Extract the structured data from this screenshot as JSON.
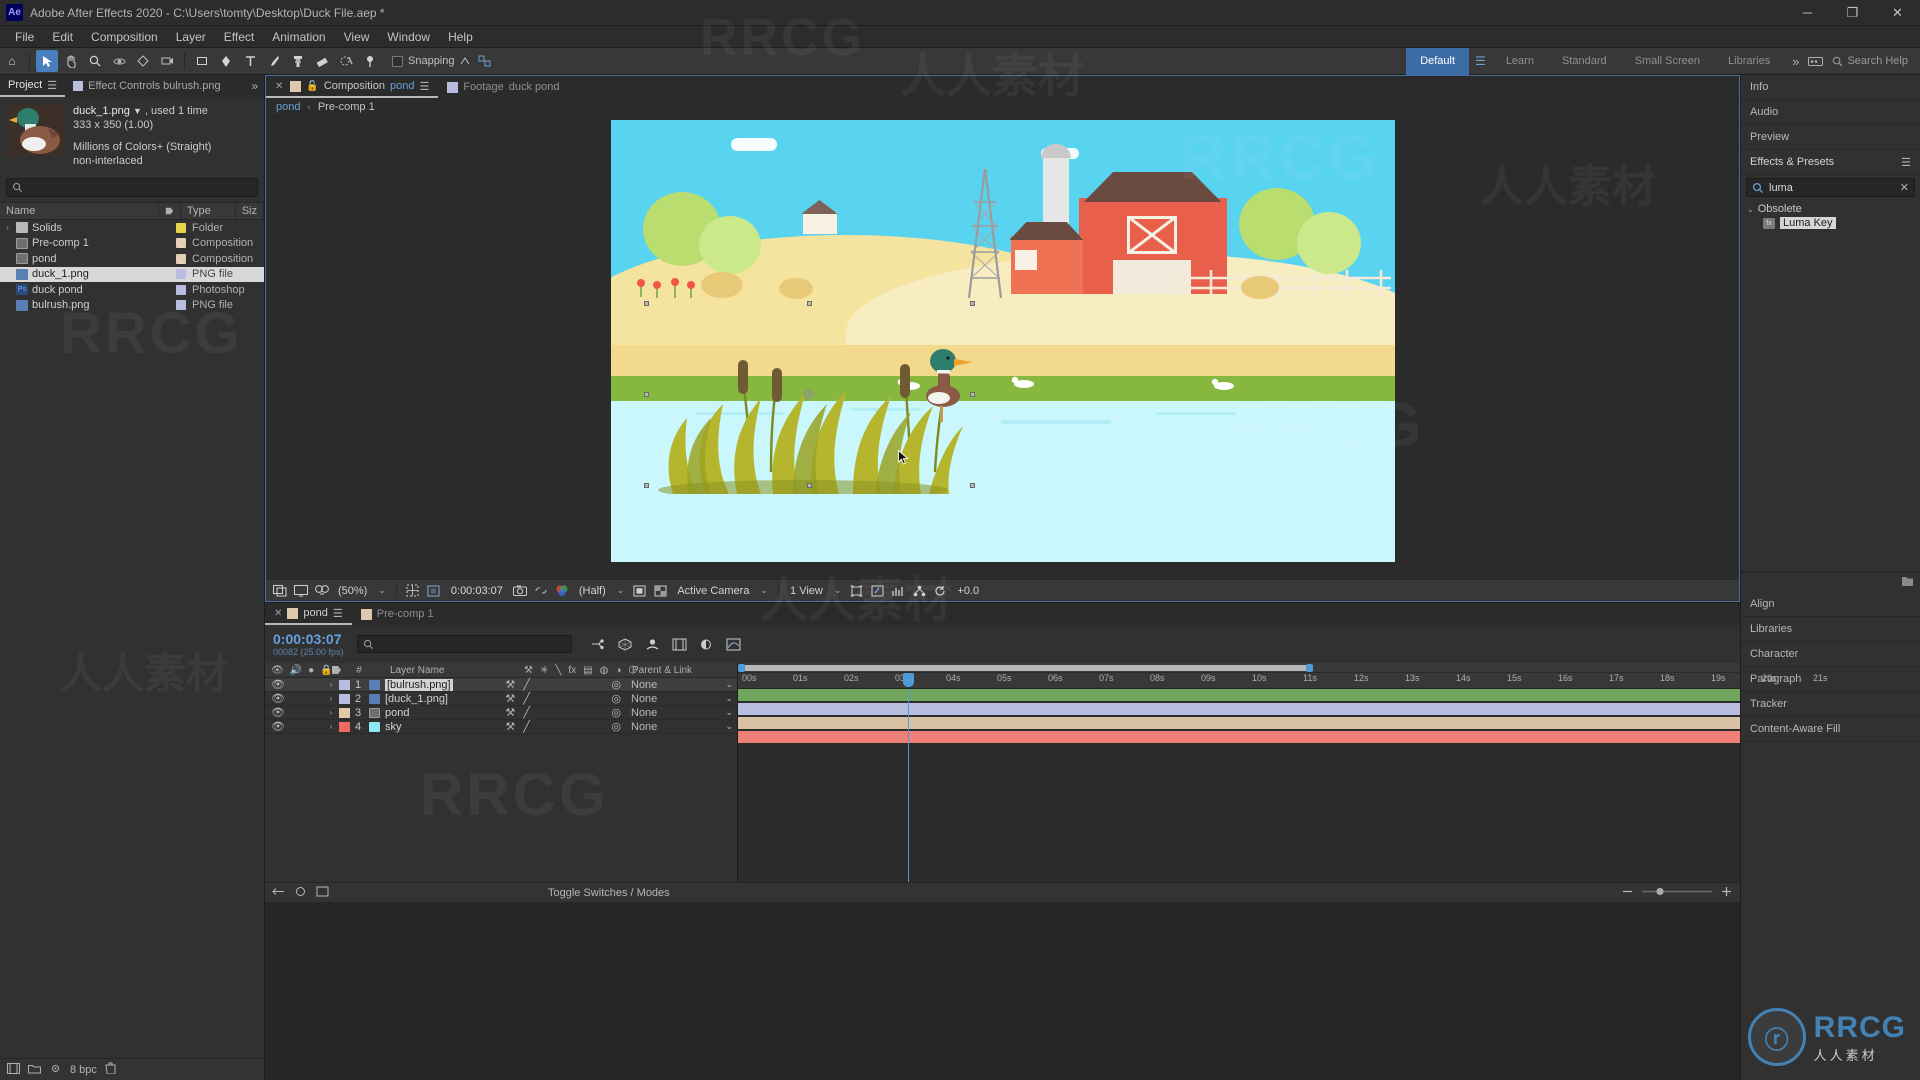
{
  "window": {
    "app_title": "Adobe After Effects 2020 - C:\\Users\\tomty\\Desktop\\Duck File.aep *",
    "logo": "Ae",
    "minimize": "─",
    "maximize": "❐",
    "close": "✕"
  },
  "menu": [
    "File",
    "Edit",
    "Composition",
    "Layer",
    "Effect",
    "Animation",
    "View",
    "Window",
    "Help"
  ],
  "toolbar": {
    "snapping_label": "Snapping",
    "workspaces": [
      "Default",
      "Learn",
      "Standard",
      "Small Screen",
      "Libraries"
    ],
    "active_workspace": "Default",
    "overflow": "»",
    "search_help_placeholder": "Search Help"
  },
  "project_panel": {
    "tabs": [
      {
        "label": "Project",
        "active": true
      },
      {
        "label": "Effect Controls bulrush.png",
        "active": false
      }
    ],
    "selected_item": {
      "name": "duck_1.png",
      "used": ", used 1 time",
      "dimensions": "333 x 350 (1.00)",
      "color_depth": "Millions of Colors+ (Straight)",
      "interlacing": "non-interlaced"
    },
    "search_placeholder": "",
    "columns": [
      "Name",
      "Type",
      "Siz"
    ],
    "items": [
      {
        "name": "Solids",
        "type": "Folder",
        "icon": "folder",
        "tag": "#e8d44a",
        "expandable": true,
        "selected": false
      },
      {
        "name": "Pre-comp 1",
        "type": "Composition",
        "icon": "comp",
        "tag": "#e2d0b8",
        "expandable": false,
        "selected": false
      },
      {
        "name": "pond",
        "type": "Composition",
        "icon": "comp",
        "tag": "#e2d0b8",
        "expandable": false,
        "selected": false
      },
      {
        "name": "duck_1.png",
        "type": "PNG file",
        "icon": "png",
        "tag": "#b9bde0",
        "expandable": false,
        "selected": true
      },
      {
        "name": "duck pond",
        "type": "Photoshop",
        "icon": "psd",
        "tag": "#b9bde0",
        "expandable": false,
        "selected": false
      },
      {
        "name": "bulrush.png",
        "type": "PNG file",
        "icon": "png",
        "tag": "#b9bde0",
        "expandable": false,
        "selected": false
      }
    ],
    "footer": {
      "bit_depth": "8 bpc"
    }
  },
  "comp_viewer": {
    "tabs": [
      {
        "prefix": "Composition",
        "name": "pond",
        "active": true
      },
      {
        "prefix": "Footage",
        "name": "duck pond",
        "active": false
      }
    ],
    "breadcrumb": {
      "root": "pond",
      "separator": "‹",
      "current": "Pre-comp 1"
    },
    "bottom_bar": {
      "zoom": "(50%)",
      "timecode": "0:00:03:07",
      "resolution": "(Half)",
      "camera": "Active Camera",
      "views": "1 View",
      "exposure": "+0.0"
    }
  },
  "right_panel": {
    "panels_top": [
      "Info",
      "Audio",
      "Preview"
    ],
    "effects_header": "Effects & Presets",
    "effects_search_value": "luma",
    "effects_tree": {
      "category": "Obsolete",
      "items": [
        {
          "label": "Luma Key",
          "selected": true
        }
      ]
    },
    "panels_bottom": [
      "Align",
      "Libraries",
      "Character",
      "Paragraph",
      "Tracker",
      "Content-Aware Fill"
    ]
  },
  "timeline": {
    "tabs": [
      {
        "label": "pond",
        "active": true
      },
      {
        "label": "Pre-comp 1",
        "active": false
      }
    ],
    "current_time": "0:00:03:07",
    "frame_info": "00082 (25.00 fps)",
    "search_placeholder": "",
    "columns": {
      "number": "#",
      "layer_name": "Layer Name",
      "parent": "Parent & Link"
    },
    "layers": [
      {
        "index": "1",
        "name": "[bulrush.png]",
        "color": "#b9bde0",
        "parent": "None",
        "selected": true,
        "icon": "png"
      },
      {
        "index": "2",
        "name": "[duck_1.png]",
        "color": "#b9bde0",
        "parent": "None",
        "selected": false,
        "icon": "png"
      },
      {
        "index": "3",
        "name": "pond",
        "color": "#e2c9a8",
        "parent": "None",
        "selected": false,
        "icon": "comp"
      },
      {
        "index": "4",
        "name": "sky",
        "color": "#ef6a60",
        "parent": "None",
        "selected": false,
        "icon": "solid"
      }
    ],
    "ruler_ticks": [
      "00s",
      "01s",
      "02s",
      "03s",
      "04s",
      "05s",
      "06s",
      "07s",
      "08s",
      "09s",
      "10s",
      "11s",
      "12s",
      "13s",
      "14s",
      "15s",
      "16s",
      "17s",
      "18s",
      "19s",
      "20s",
      "21s"
    ],
    "work_area_end": "11s",
    "footer_label": "Toggle Switches / Modes"
  },
  "watermarks": {
    "brand": "RRCG",
    "cjk": "人人素材",
    "logo_mark": "ⓡ",
    "logo_text": "RRCG",
    "logo_sub": "人人素材"
  },
  "colors": {
    "accent_blue": "#4f9bd8",
    "selection": "#3d6ba5",
    "panel_bg": "#313131",
    "toolbar_bg": "#383838"
  }
}
